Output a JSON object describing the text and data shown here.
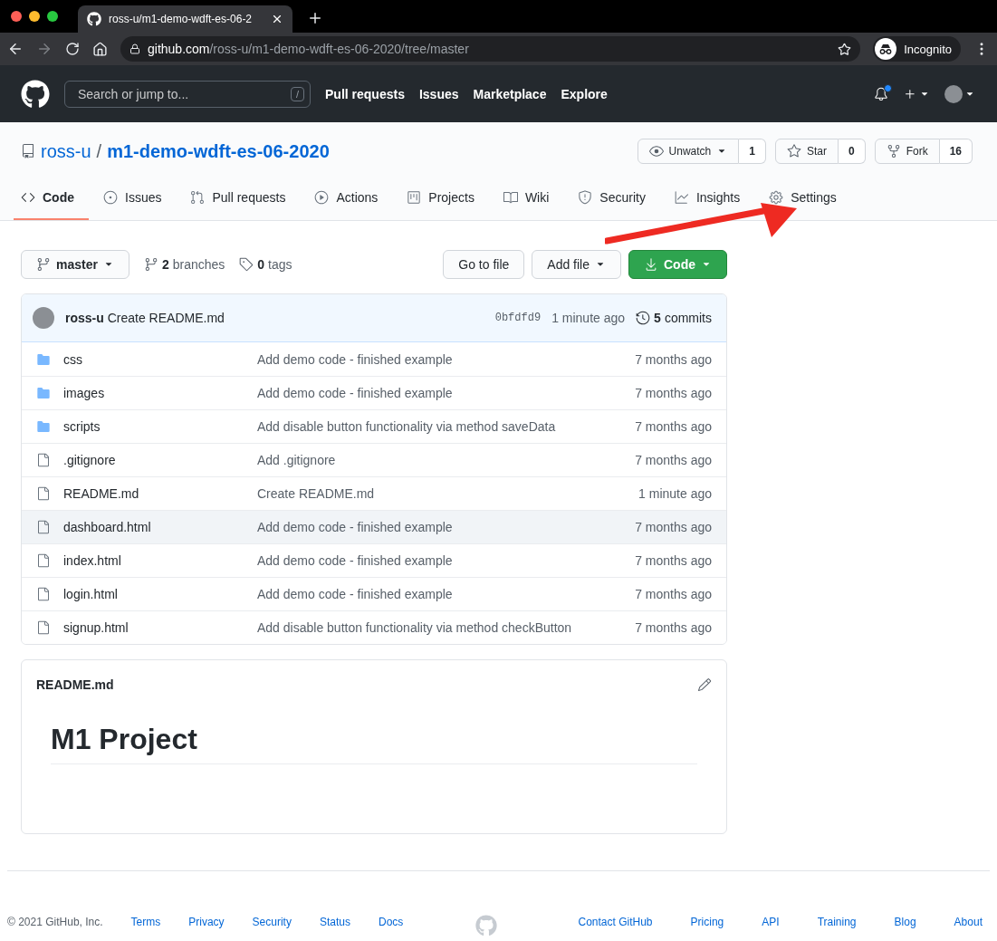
{
  "browser": {
    "tab_title": "ross-u/m1-demo-wdft-es-06-2",
    "url_host": "github.com",
    "url_path": "/ross-u/m1-demo-wdft-es-06-2020/tree/master",
    "profile": "Incognito"
  },
  "header": {
    "search_placeholder": "Search or jump to...",
    "search_key": "/",
    "nav": [
      "Pull requests",
      "Issues",
      "Marketplace",
      "Explore"
    ],
    "unread_notifications": true
  },
  "repo": {
    "owner": "ross-u",
    "separator": "/",
    "name": "m1-demo-wdft-es-06-2020",
    "actions": [
      {
        "label": "Unwatch",
        "count": "1",
        "caret": true
      },
      {
        "label": "Star",
        "count": "0",
        "caret": false
      },
      {
        "label": "Fork",
        "count": "16",
        "caret": false
      }
    ]
  },
  "tabs": [
    {
      "label": "Code",
      "selected": true
    },
    {
      "label": "Issues",
      "selected": false
    },
    {
      "label": "Pull requests",
      "selected": false
    },
    {
      "label": "Actions",
      "selected": false
    },
    {
      "label": "Projects",
      "selected": false
    },
    {
      "label": "Wiki",
      "selected": false
    },
    {
      "label": "Security",
      "selected": false
    },
    {
      "label": "Insights",
      "selected": false
    },
    {
      "label": "Settings",
      "selected": false
    }
  ],
  "branch_bar": {
    "branch": "master",
    "branches_count": "2",
    "branches_label": "branches",
    "tags_count": "0",
    "tags_label": "tags",
    "buttons": [
      {
        "label": "Go to file",
        "kind": "plain"
      },
      {
        "label": "Add file",
        "kind": "menu"
      },
      {
        "label": "Code",
        "kind": "primary"
      }
    ]
  },
  "latest_commit": {
    "author": "ross-u",
    "message": "Create README.md",
    "hash": "0bfdfd9",
    "time": "1 minute ago",
    "commits_count": "5",
    "commits_label": "commits"
  },
  "files": [
    {
      "kind": "folder",
      "name": "css",
      "message": "Add demo code - finished example",
      "time": "7 months ago",
      "selected": false
    },
    {
      "kind": "folder",
      "name": "images",
      "message": "Add demo code - finished example",
      "time": "7 months ago",
      "selected": false
    },
    {
      "kind": "folder",
      "name": "scripts",
      "message": "Add disable button functionality via method saveData",
      "time": "7 months ago",
      "selected": false
    },
    {
      "kind": "file",
      "name": ".gitignore",
      "message": "Add .gitignore",
      "time": "7 months ago",
      "selected": false
    },
    {
      "kind": "file",
      "name": "README.md",
      "message": "Create README.md",
      "time": "1 minute ago",
      "selected": false
    },
    {
      "kind": "file",
      "name": "dashboard.html",
      "message": "Add demo code - finished example",
      "time": "7 months ago",
      "selected": true
    },
    {
      "kind": "file",
      "name": "index.html",
      "message": "Add demo code - finished example",
      "time": "7 months ago",
      "selected": false
    },
    {
      "kind": "file",
      "name": "login.html",
      "message": "Add demo code - finished example",
      "time": "7 months ago",
      "selected": false
    },
    {
      "kind": "file",
      "name": "signup.html",
      "message": "Add disable button functionality via method checkButton",
      "time": "7 months ago",
      "selected": false
    }
  ],
  "readme": {
    "filename": "README.md",
    "heading": "M1 Project"
  },
  "footer": {
    "copyright": "© 2021 GitHub, Inc.",
    "left_links": [
      "Terms",
      "Privacy",
      "Security",
      "Status",
      "Docs"
    ],
    "right_links": [
      "Contact GitHub",
      "Pricing",
      "API",
      "Training",
      "Blog",
      "About"
    ]
  }
}
